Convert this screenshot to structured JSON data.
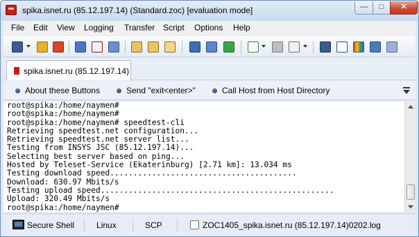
{
  "window": {
    "title": "spika.isnet.ru (85.12.197.14) (Standard.zoc) [evaluation mode]",
    "minimize_glyph": "—",
    "maximize_glyph": "□",
    "close_glyph": "✕"
  },
  "menu": [
    "File",
    "Edit",
    "View",
    "Logging",
    "Transfer",
    "Script",
    "Options",
    "Help"
  ],
  "toolbar": {
    "icons": [
      "new-session-icon",
      "favorites-icon",
      "disconnect-icon",
      "quick-connect-icon",
      "close-session-icon",
      "address-book-icon",
      "copy-icon",
      "paste-icon",
      "edit-icon",
      "print-icon",
      "send-file-icon",
      "upload-icon",
      "download-icon",
      "run-script-icon",
      "stop-icon",
      "edit-script-icon",
      "host-directory-icon",
      "font-icon",
      "colors-icon",
      "options-icon"
    ]
  },
  "tab": {
    "label": "spika.isnet.ru (85.12.197.14)"
  },
  "buttonbar": {
    "items": [
      "About these Buttons",
      "Send \"exit<enter>\"",
      "Call Host from Host Directory"
    ]
  },
  "terminal": {
    "lines": [
      "root@spika:/home/naymen#",
      "root@spika:/home/naymen#",
      "root@spika:/home/naymen# speedtest-cli",
      "Retrieving speedtest.net configuration...",
      "Retrieving speedtest.net server list...",
      "Testing from INSYS JSC (85.12.197.14)...",
      "Selecting best server based on ping...",
      "Hosted by Teleset-Service (Ekaterinburg) [2.71 km]: 13.034 ms",
      "Testing download speed........................................",
      "Download: 630.97 Mbits/s",
      "Testing upload speed..................................................",
      "Upload: 320.49 Mbits/s",
      "root@spika:/home/naymen#"
    ]
  },
  "status": {
    "connection": "Secure Shell",
    "emulation": "Linux",
    "transfer": "SCP",
    "logfile": "ZOC1405_spika.isnet.ru (85.12.197.14)0202.log",
    "log_checked": false
  }
}
